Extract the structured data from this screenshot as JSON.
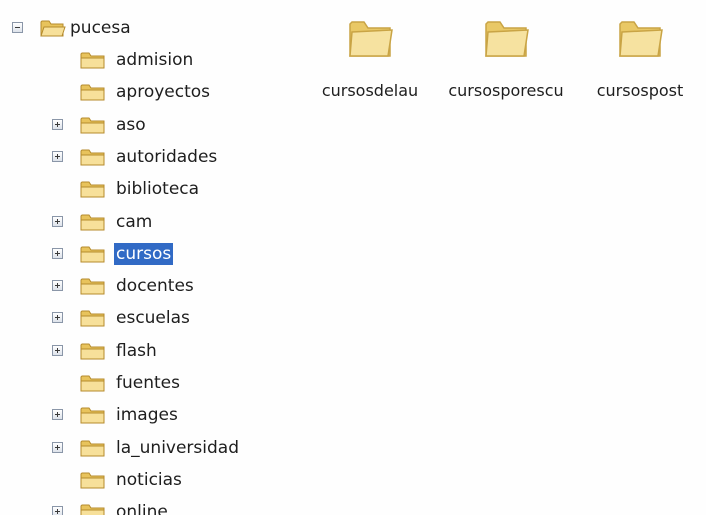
{
  "tree": {
    "root": {
      "label": "pucesa",
      "expanded": true
    },
    "items": [
      {
        "label": "admision",
        "expandable": false,
        "selected": false
      },
      {
        "label": "aproyectos",
        "expandable": false,
        "selected": false
      },
      {
        "label": "aso",
        "expandable": true,
        "selected": false
      },
      {
        "label": "autoridades",
        "expandable": true,
        "selected": false
      },
      {
        "label": "biblioteca",
        "expandable": false,
        "selected": false
      },
      {
        "label": "cam",
        "expandable": true,
        "selected": false
      },
      {
        "label": "cursos",
        "expandable": true,
        "selected": true
      },
      {
        "label": "docentes",
        "expandable": true,
        "selected": false
      },
      {
        "label": "escuelas",
        "expandable": true,
        "selected": false
      },
      {
        "label": "flash",
        "expandable": true,
        "selected": false
      },
      {
        "label": "fuentes",
        "expandable": false,
        "selected": false
      },
      {
        "label": "images",
        "expandable": true,
        "selected": false
      },
      {
        "label": "la_universidad",
        "expandable": true,
        "selected": false
      },
      {
        "label": "noticias",
        "expandable": false,
        "selected": false
      },
      {
        "label": "online",
        "expandable": true,
        "selected": false
      }
    ]
  },
  "content": {
    "folders": [
      {
        "label": "cursosdelau"
      },
      {
        "label": "cursosporescu"
      },
      {
        "label": "cursospost"
      }
    ]
  },
  "colors": {
    "selection": "#316ac5",
    "folder_fill": "#f5dc8c",
    "folder_edge": "#c9a445"
  }
}
